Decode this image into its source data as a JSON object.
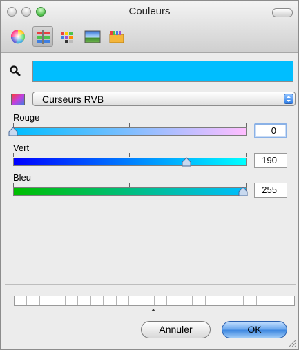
{
  "window": {
    "title": "Couleurs"
  },
  "toolbar": {
    "tabs": [
      {
        "icon": "color-wheel-icon"
      },
      {
        "icon": "sliders-icon",
        "active": true
      },
      {
        "icon": "color-palette-icon"
      },
      {
        "icon": "image-palette-icon"
      },
      {
        "icon": "crayons-icon"
      }
    ]
  },
  "current_color": "#00beff",
  "mode": {
    "selected": "Curseurs RVB"
  },
  "sliders": [
    {
      "label": "Rouge",
      "value": "0"
    },
    {
      "label": "Vert",
      "value": "190"
    },
    {
      "label": "Bleu",
      "value": "255"
    }
  ],
  "buttons": {
    "cancel": "Annuler",
    "ok": "OK"
  },
  "icons": {
    "search": "magnifier-icon",
    "mode": "color-mode-icon",
    "resize": "resize-grip-icon"
  }
}
